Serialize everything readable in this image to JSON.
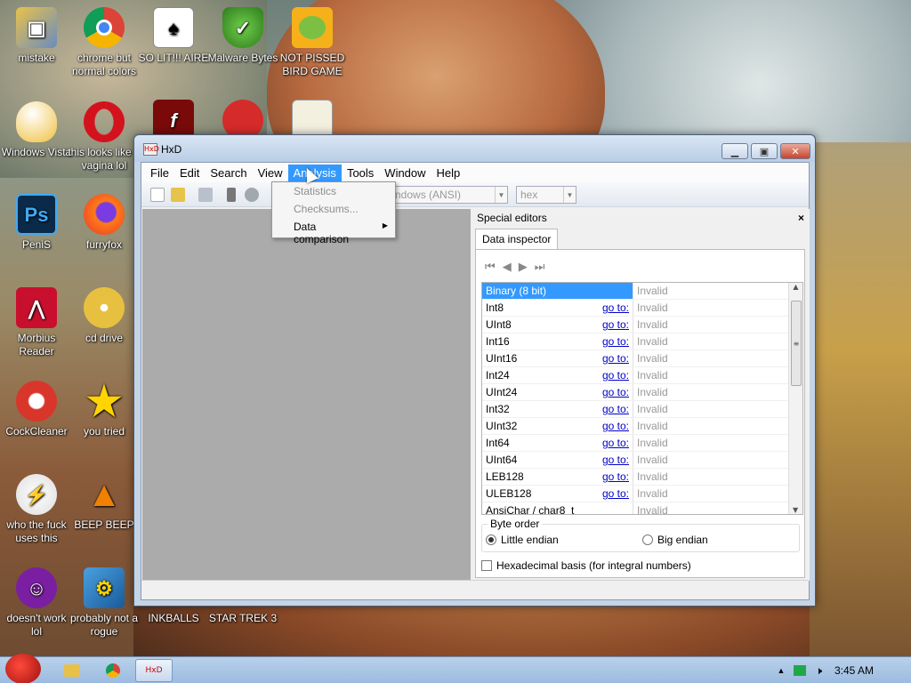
{
  "desktop": {
    "icons": [
      {
        "label": "mistake"
      },
      {
        "label": "chrome but normal colors"
      },
      {
        "label": "SO LIT!!! AIRE"
      },
      {
        "label": "Malware Bytes"
      },
      {
        "label": "NOT PISSED BIRD GAME"
      },
      {
        "label": "Windows Vista"
      },
      {
        "label": "this looks like a vagina lol"
      },
      {
        "label": "PeniS"
      },
      {
        "label": "furryfox"
      },
      {
        "label": "Morbius Reader"
      },
      {
        "label": "cd drive"
      },
      {
        "label": "CockCleaner"
      },
      {
        "label": "you tried"
      },
      {
        "label": "who the fuck uses this"
      },
      {
        "label": "BEEP BEEP"
      },
      {
        "label": "doesn't work lol"
      },
      {
        "label": "probably not a rogue"
      },
      {
        "label": "INKBALLS"
      },
      {
        "label": "STAR TREK 3"
      }
    ]
  },
  "window": {
    "title": "HxD",
    "menu": [
      "File",
      "Edit",
      "Search",
      "View",
      "Analysis",
      "Tools",
      "Window",
      "Help"
    ],
    "active_menu": "Analysis",
    "toolbar": {
      "encoding": "Windows (ANSI)",
      "encoding_visible": "ndows (ANSI)",
      "base": "hex"
    },
    "analysis_menu": [
      {
        "label": "Statistics",
        "enabled": false
      },
      {
        "label": "Checksums...",
        "enabled": false
      },
      {
        "label": "Data comparison",
        "enabled": true,
        "submenu": true
      }
    ],
    "special_editors": {
      "title": "Special editors",
      "close": "×",
      "tab": "Data inspector",
      "rows": [
        {
          "type": "Binary (8 bit)",
          "goto": "",
          "value": "Invalid"
        },
        {
          "type": "Int8",
          "goto": "go to:",
          "value": "Invalid"
        },
        {
          "type": "UInt8",
          "goto": "go to:",
          "value": "Invalid"
        },
        {
          "type": "Int16",
          "goto": "go to:",
          "value": "Invalid"
        },
        {
          "type": "UInt16",
          "goto": "go to:",
          "value": "Invalid"
        },
        {
          "type": "Int24",
          "goto": "go to:",
          "value": "Invalid"
        },
        {
          "type": "UInt24",
          "goto": "go to:",
          "value": "Invalid"
        },
        {
          "type": "Int32",
          "goto": "go to:",
          "value": "Invalid"
        },
        {
          "type": "UInt32",
          "goto": "go to:",
          "value": "Invalid"
        },
        {
          "type": "Int64",
          "goto": "go to:",
          "value": "Invalid"
        },
        {
          "type": "UInt64",
          "goto": "go to:",
          "value": "Invalid"
        },
        {
          "type": "LEB128",
          "goto": "go to:",
          "value": "Invalid"
        },
        {
          "type": "ULEB128",
          "goto": "go to:",
          "value": "Invalid"
        },
        {
          "type": "AnsiChar / char8_t",
          "goto": "",
          "value": "Invalid"
        }
      ],
      "byte_order_label": "Byte order",
      "little_endian": "Little endian",
      "big_endian": "Big endian",
      "byte_order_selected": "Little endian",
      "hex_basis_label": "Hexadecimal basis (for integral numbers)",
      "hex_basis_checked": false
    }
  },
  "taskbar": {
    "clock": "3:45 AM"
  }
}
